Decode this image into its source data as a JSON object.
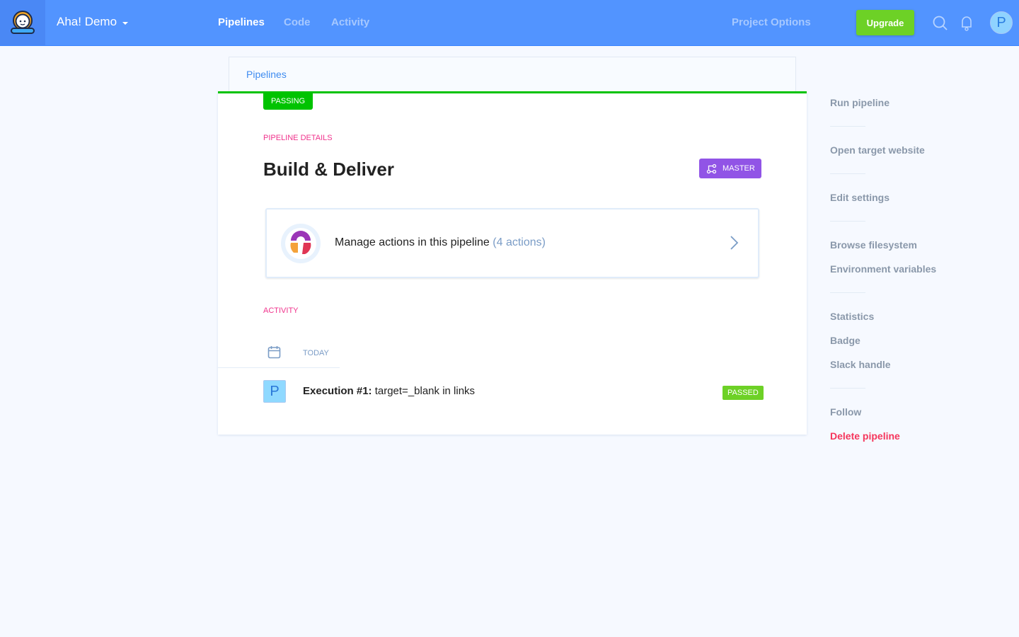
{
  "header": {
    "project": "Aha! Demo",
    "nav": [
      "Pipelines",
      "Code",
      "Activity"
    ],
    "project_options": "Project Options",
    "upgrade": "Upgrade",
    "avatar_letter": "P"
  },
  "breadcrumb": "Pipelines",
  "pipeline": {
    "status": "PASSING",
    "section_label": "PIPELINE DETAILS",
    "title": "Build & Deliver",
    "branch": "MASTER",
    "actions_text": "Manage actions in this pipeline",
    "actions_count": "(4 actions)",
    "activity_label": "ACTIVITY",
    "day": "TODAY",
    "execution": {
      "avatar": "P",
      "label": "Execution #1:",
      "message": "target=_blank in links",
      "status": "PASSED"
    }
  },
  "sidebar": [
    "Run pipeline",
    "Open target website",
    "Edit settings",
    "Browse filesystem",
    "Environment variables",
    "Statistics",
    "Badge",
    "Slack handle",
    "Follow",
    "Delete pipeline"
  ],
  "colors": {
    "header": "#5294ff",
    "passing": "#00c300",
    "passed": "#6dd126",
    "branch": "#9154e6",
    "label": "#f0338c",
    "danger": "#f5365c"
  }
}
